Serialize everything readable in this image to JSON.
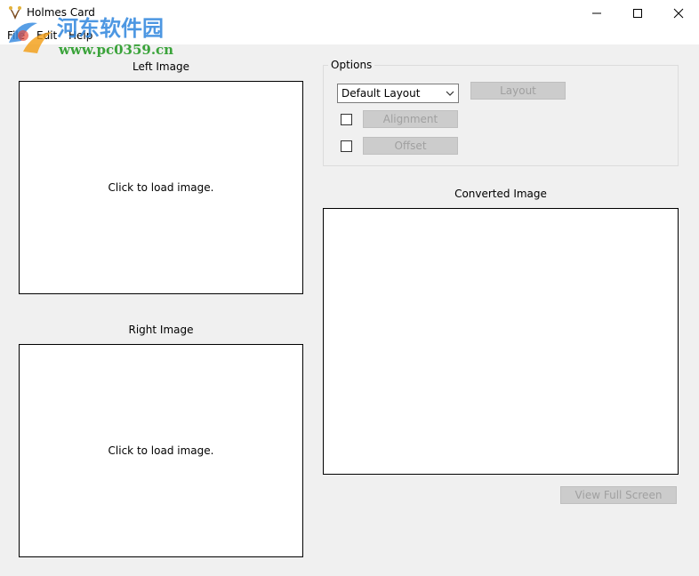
{
  "window": {
    "title": "Holmes Card",
    "controls": {
      "minimize": "—",
      "maximize": "☐",
      "close": "✕"
    }
  },
  "menu": [
    "File",
    "Edit",
    "Help"
  ],
  "watermark": {
    "cn": "河东软件园",
    "url": "www.pc0359.cn"
  },
  "left_image": {
    "label": "Left Image",
    "placeholder": "Click to load image."
  },
  "right_image": {
    "label": "Right Image",
    "placeholder": "Click to load image."
  },
  "options": {
    "label": "Options",
    "layout_select": "Default Layout",
    "layout_button": "Layout",
    "alignment_button": "Alignment",
    "offset_button": "Offset"
  },
  "converted": {
    "label": "Converted Image"
  },
  "view_full_screen": "View Full Screen",
  "colors": {
    "watermark_blue": "#2e86de",
    "watermark_green": "#3aa33a",
    "disabled_text": "#a0a0a0"
  }
}
